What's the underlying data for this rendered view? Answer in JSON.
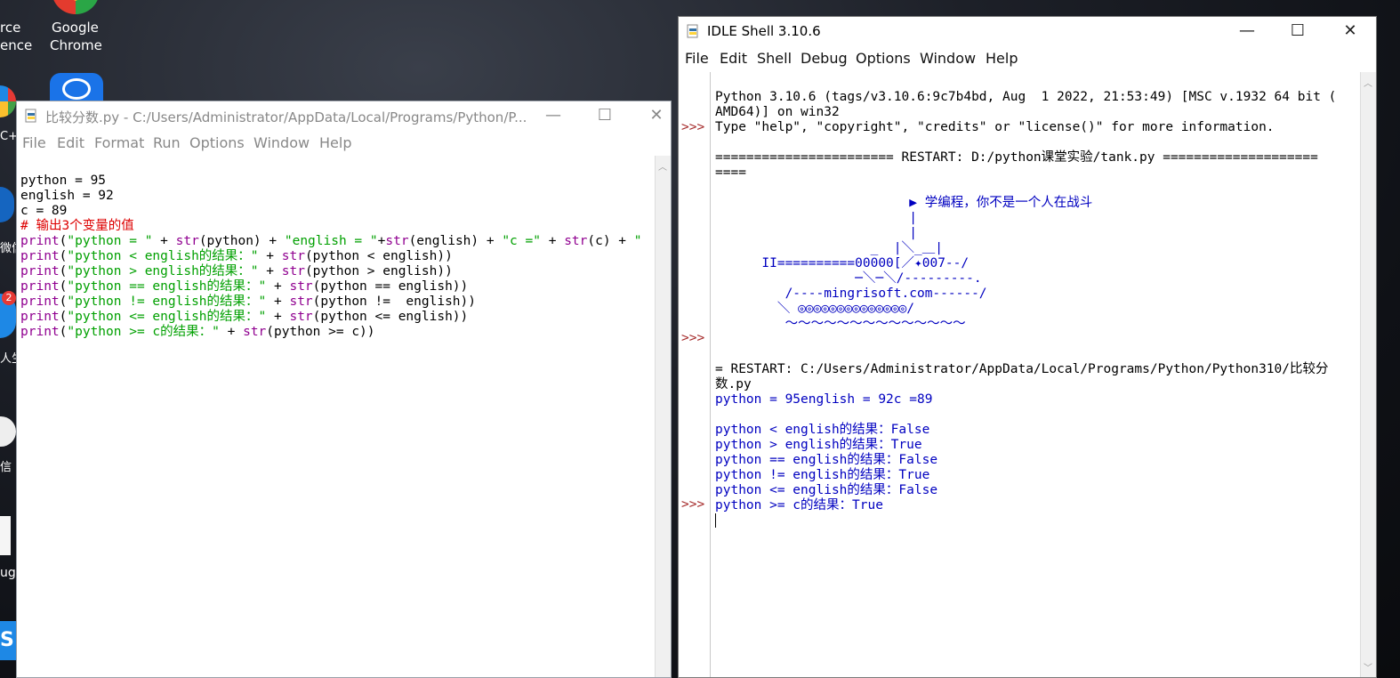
{
  "desktop": {
    "left_labels": [
      "rce",
      "ence",
      "C+",
      "微信",
      "人生",
      "信",
      "ug",
      "S"
    ],
    "chrome_label_1": "Google",
    "chrome_label_2": "Chrome",
    "badge": "2"
  },
  "editor": {
    "title": "比较分数.py - C:/Users/Administrator/AppData/Local/Programs/Python/P...",
    "menu": [
      "File",
      "Edit",
      "Format",
      "Run",
      "Options",
      "Window",
      "Help"
    ],
    "controls": {
      "minimize": "—",
      "maximize": "☐",
      "close": "✕"
    },
    "lines": [
      "python = 95",
      "english = 92",
      "c = 89",
      "# 输出3个变量的值",
      "print(\"python = \" + str(python) + \"english = \"+str(english) + \"c =\" + str(c) + \"",
      "print(\"python < english的结果：\" + str(python < english))",
      "print(\"python > english的结果：\" + str(python > english))",
      "print(\"python == english的结果：\" + str(python == english))",
      "print(\"python != english的结果：\" + str(python !=  english))",
      "print(\"python <= english的结果：\" + str(python <= english))",
      "print(\"python >= c的结果：\" + str(python >= c))"
    ]
  },
  "shell": {
    "title": "IDLE Shell 3.10.6",
    "menu": [
      "File",
      "Edit",
      "Shell",
      "Debug",
      "Options",
      "Window",
      "Help"
    ],
    "controls": {
      "minimize": "—",
      "maximize": "☐",
      "close": "✕"
    },
    "prompt": ">>>",
    "banner": [
      "Python 3.10.6 (tags/v3.10.6:9c7b4bd, Aug  1 2022, 21:53:49) [MSC v.1932 64 bit (",
      "AMD64)] on win32",
      "Type \"help\", \"copyright\", \"credits\" or \"license()\" for more information."
    ],
    "restart1": [
      "======================= RESTART: D:/python课堂实验/tank.py ====================",
      "===="
    ],
    "tank_art": [
      "                         ▶ 学编程，你不是一个人在战斗",
      "                         |",
      "                         |",
      "                    _  |＼_＿|",
      "      II==========00000[／✦007--/",
      "                  ─＼─＼/---------.",
      "         /----mingrisoft.com------/",
      "        ＼ ◎◎◎◎◎◎◎◎◎◎◎◎◎◎/",
      "         ～～～～～～～～～～～～～～"
    ],
    "restart2": [
      "= RESTART: C:/Users/Administrator/AppData/Local/Programs/Python/Python310/比较分",
      "数.py"
    ],
    "output": [
      "python = 95english = 92c =89",
      "",
      "python < english的结果：False",
      "python > english的结果：True",
      "python == english的结果：False",
      "python != english的结果：True",
      "python <= english的结果：False",
      "python >= c的结果：True"
    ]
  }
}
